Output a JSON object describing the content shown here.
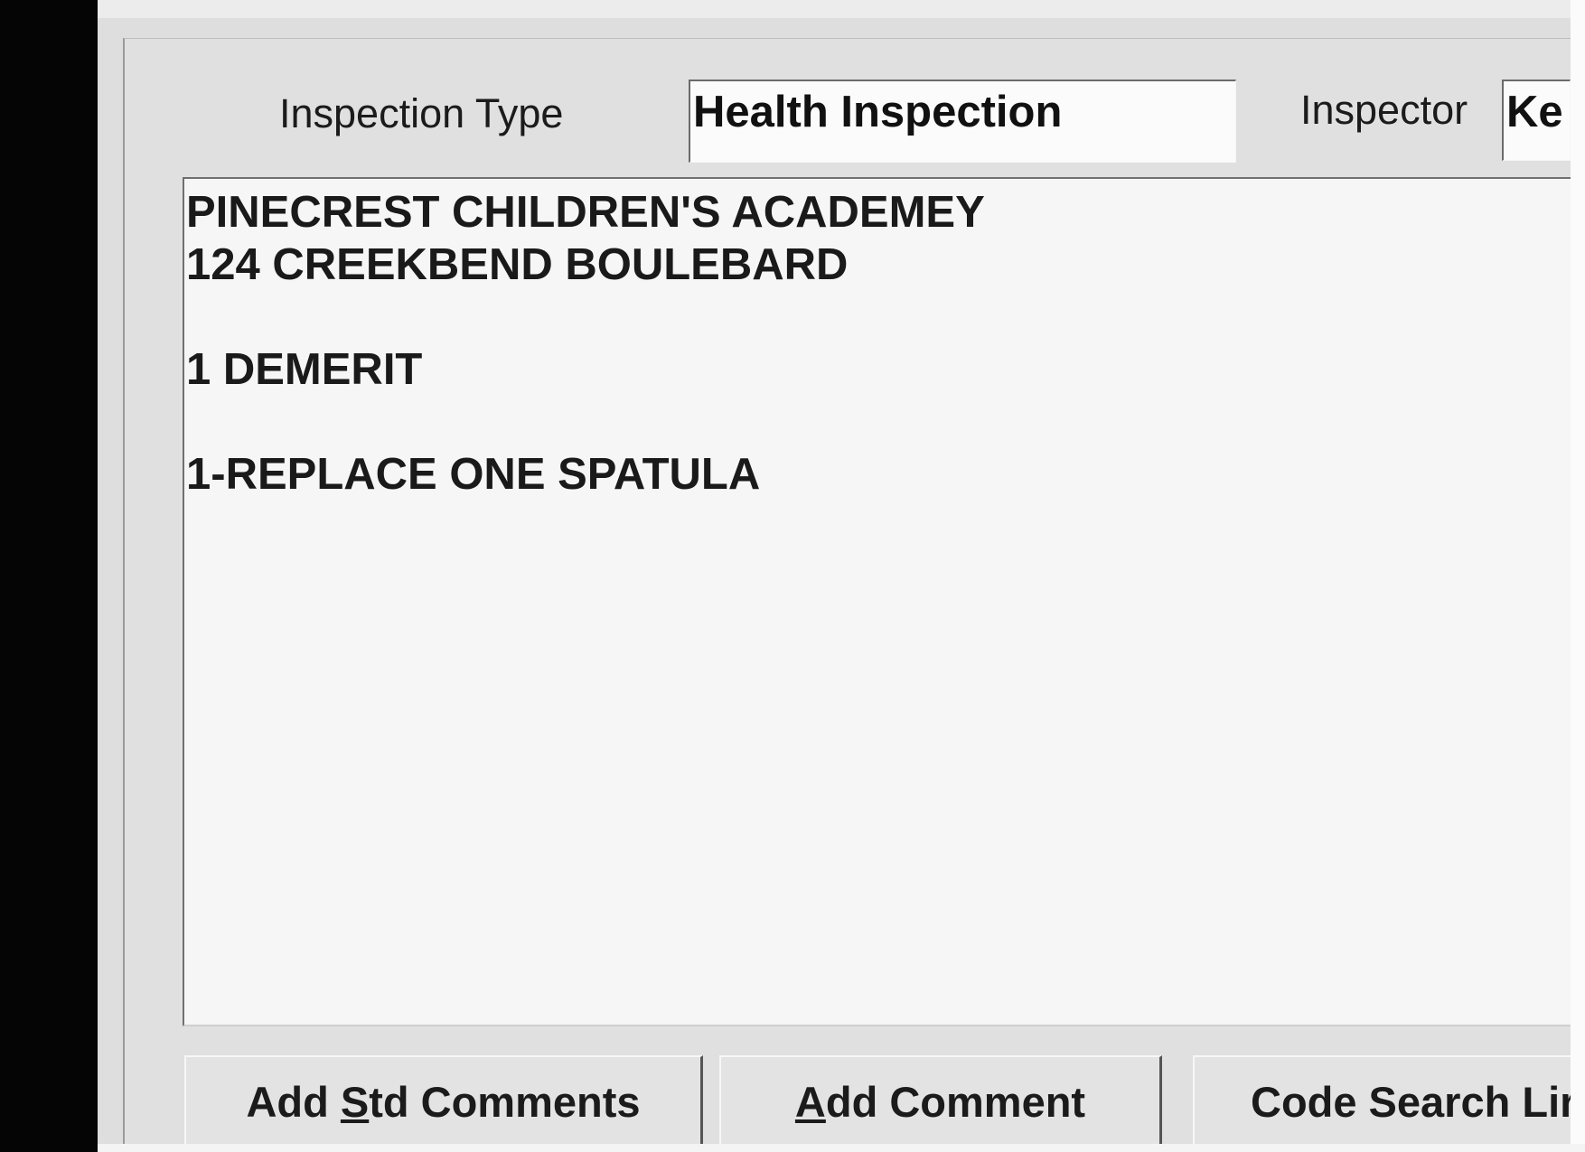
{
  "form": {
    "inspection_type_label": "Inspection Type",
    "inspection_type_value": "Health Inspection",
    "inspector_label": "Inspector",
    "inspector_value": "Ke"
  },
  "comments": {
    "lines": [
      "PINECREST CHILDREN'S ACADEMEY",
      "124 CREEKBEND BOULEBARD",
      "",
      "1 DEMERIT",
      "",
      "1-REPLACE ONE SPATULA"
    ]
  },
  "buttons": {
    "add_std_comments": {
      "pre": "Add ",
      "accel": "S",
      "post": "td Comments"
    },
    "add_comment": {
      "pre": "",
      "accel": "A",
      "post": "dd Comment"
    },
    "code_search": {
      "label": "Code Search Lir"
    }
  }
}
